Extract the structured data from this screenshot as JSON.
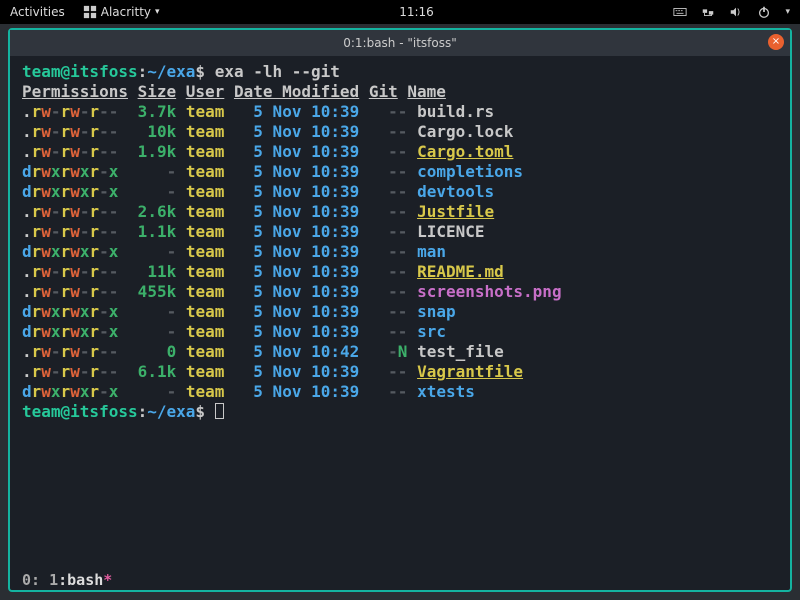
{
  "gnome": {
    "activities": "Activities",
    "app_icon": "terminal-grid-icon",
    "app_name": "Alacritty",
    "clock": "11:16",
    "tray_icons": [
      "keyboard-icon",
      "network-icon",
      "volume-icon",
      "power-icon",
      "chevron-down-icon"
    ]
  },
  "window": {
    "title": "0:1:bash - \"itsfoss\"",
    "close_label": "×"
  },
  "prompt": {
    "user_host": "team@itsfoss",
    "cwd": "~/exa",
    "sep": "$",
    "command": "exa -lh --git"
  },
  "columns": {
    "perm": "Permissions",
    "size": "Size",
    "user": "User",
    "date": "Date Modified",
    "git": "Git",
    "name": "Name"
  },
  "rows": [
    {
      "perm": ".rw-rw-r--",
      "size": "3.7k",
      "user": "team",
      "date": "5 Nov 10:39",
      "git": "--",
      "name": "build.rs",
      "kind": "norm"
    },
    {
      "perm": ".rw-rw-r--",
      "size": "10k",
      "user": "team",
      "date": "5 Nov 10:39",
      "git": "--",
      "name": "Cargo.lock",
      "kind": "norm"
    },
    {
      "perm": ".rw-rw-r--",
      "size": "1.9k",
      "user": "team",
      "date": "5 Nov 10:39",
      "git": "--",
      "name": "Cargo.toml",
      "kind": "spec"
    },
    {
      "perm": "drwxrwxr-x",
      "size": "-",
      "user": "team",
      "date": "5 Nov 10:39",
      "git": "--",
      "name": "completions",
      "kind": "dir"
    },
    {
      "perm": "drwxrwxr-x",
      "size": "-",
      "user": "team",
      "date": "5 Nov 10:39",
      "git": "--",
      "name": "devtools",
      "kind": "dir"
    },
    {
      "perm": ".rw-rw-r--",
      "size": "2.6k",
      "user": "team",
      "date": "5 Nov 10:39",
      "git": "--",
      "name": "Justfile",
      "kind": "spec"
    },
    {
      "perm": ".rw-rw-r--",
      "size": "1.1k",
      "user": "team",
      "date": "5 Nov 10:39",
      "git": "--",
      "name": "LICENCE",
      "kind": "norm"
    },
    {
      "perm": "drwxrwxr-x",
      "size": "-",
      "user": "team",
      "date": "5 Nov 10:39",
      "git": "--",
      "name": "man",
      "kind": "dir"
    },
    {
      "perm": ".rw-rw-r--",
      "size": "11k",
      "user": "team",
      "date": "5 Nov 10:39",
      "git": "--",
      "name": "README.md",
      "kind": "spec"
    },
    {
      "perm": ".rw-rw-r--",
      "size": "455k",
      "user": "team",
      "date": "5 Nov 10:39",
      "git": "--",
      "name": "screenshots.png",
      "kind": "img"
    },
    {
      "perm": "drwxrwxr-x",
      "size": "-",
      "user": "team",
      "date": "5 Nov 10:39",
      "git": "--",
      "name": "snap",
      "kind": "dir"
    },
    {
      "perm": "drwxrwxr-x",
      "size": "-",
      "user": "team",
      "date": "5 Nov 10:39",
      "git": "--",
      "name": "src",
      "kind": "dir"
    },
    {
      "perm": ".rw-rw-r--",
      "size": "0",
      "user": "team",
      "date": "5 Nov 10:42",
      "git": "-N",
      "name": "test_file",
      "kind": "norm"
    },
    {
      "perm": ".rw-rw-r--",
      "size": "6.1k",
      "user": "team",
      "date": "5 Nov 10:39",
      "git": "--",
      "name": "Vagrantfile",
      "kind": "spec"
    },
    {
      "perm": "drwxrwxr-x",
      "size": "-",
      "user": "team",
      "date": "5 Nov 10:39",
      "git": "--",
      "name": "xtests",
      "kind": "dir"
    }
  ],
  "statusline": {
    "left": "0:",
    "session": "1",
    "proc": ":bash",
    "mark": "*"
  }
}
